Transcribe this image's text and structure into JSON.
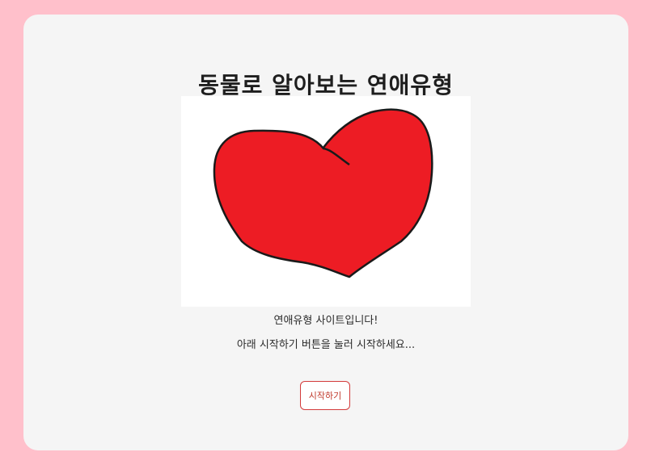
{
  "page": {
    "title": "동물로 알아보는 연애유형",
    "intro_line1": "연애유형 사이트입니다!",
    "intro_line2": "아래 시작하기 버튼을 눌러 시작하세요...",
    "start_button_label": "시작하기"
  },
  "colors": {
    "background": "#ffc0cb",
    "card": "#f5f5f5",
    "heart": "#ed1c24",
    "button_border": "#d33a3a"
  },
  "image": {
    "icon": "heart-drawing"
  }
}
